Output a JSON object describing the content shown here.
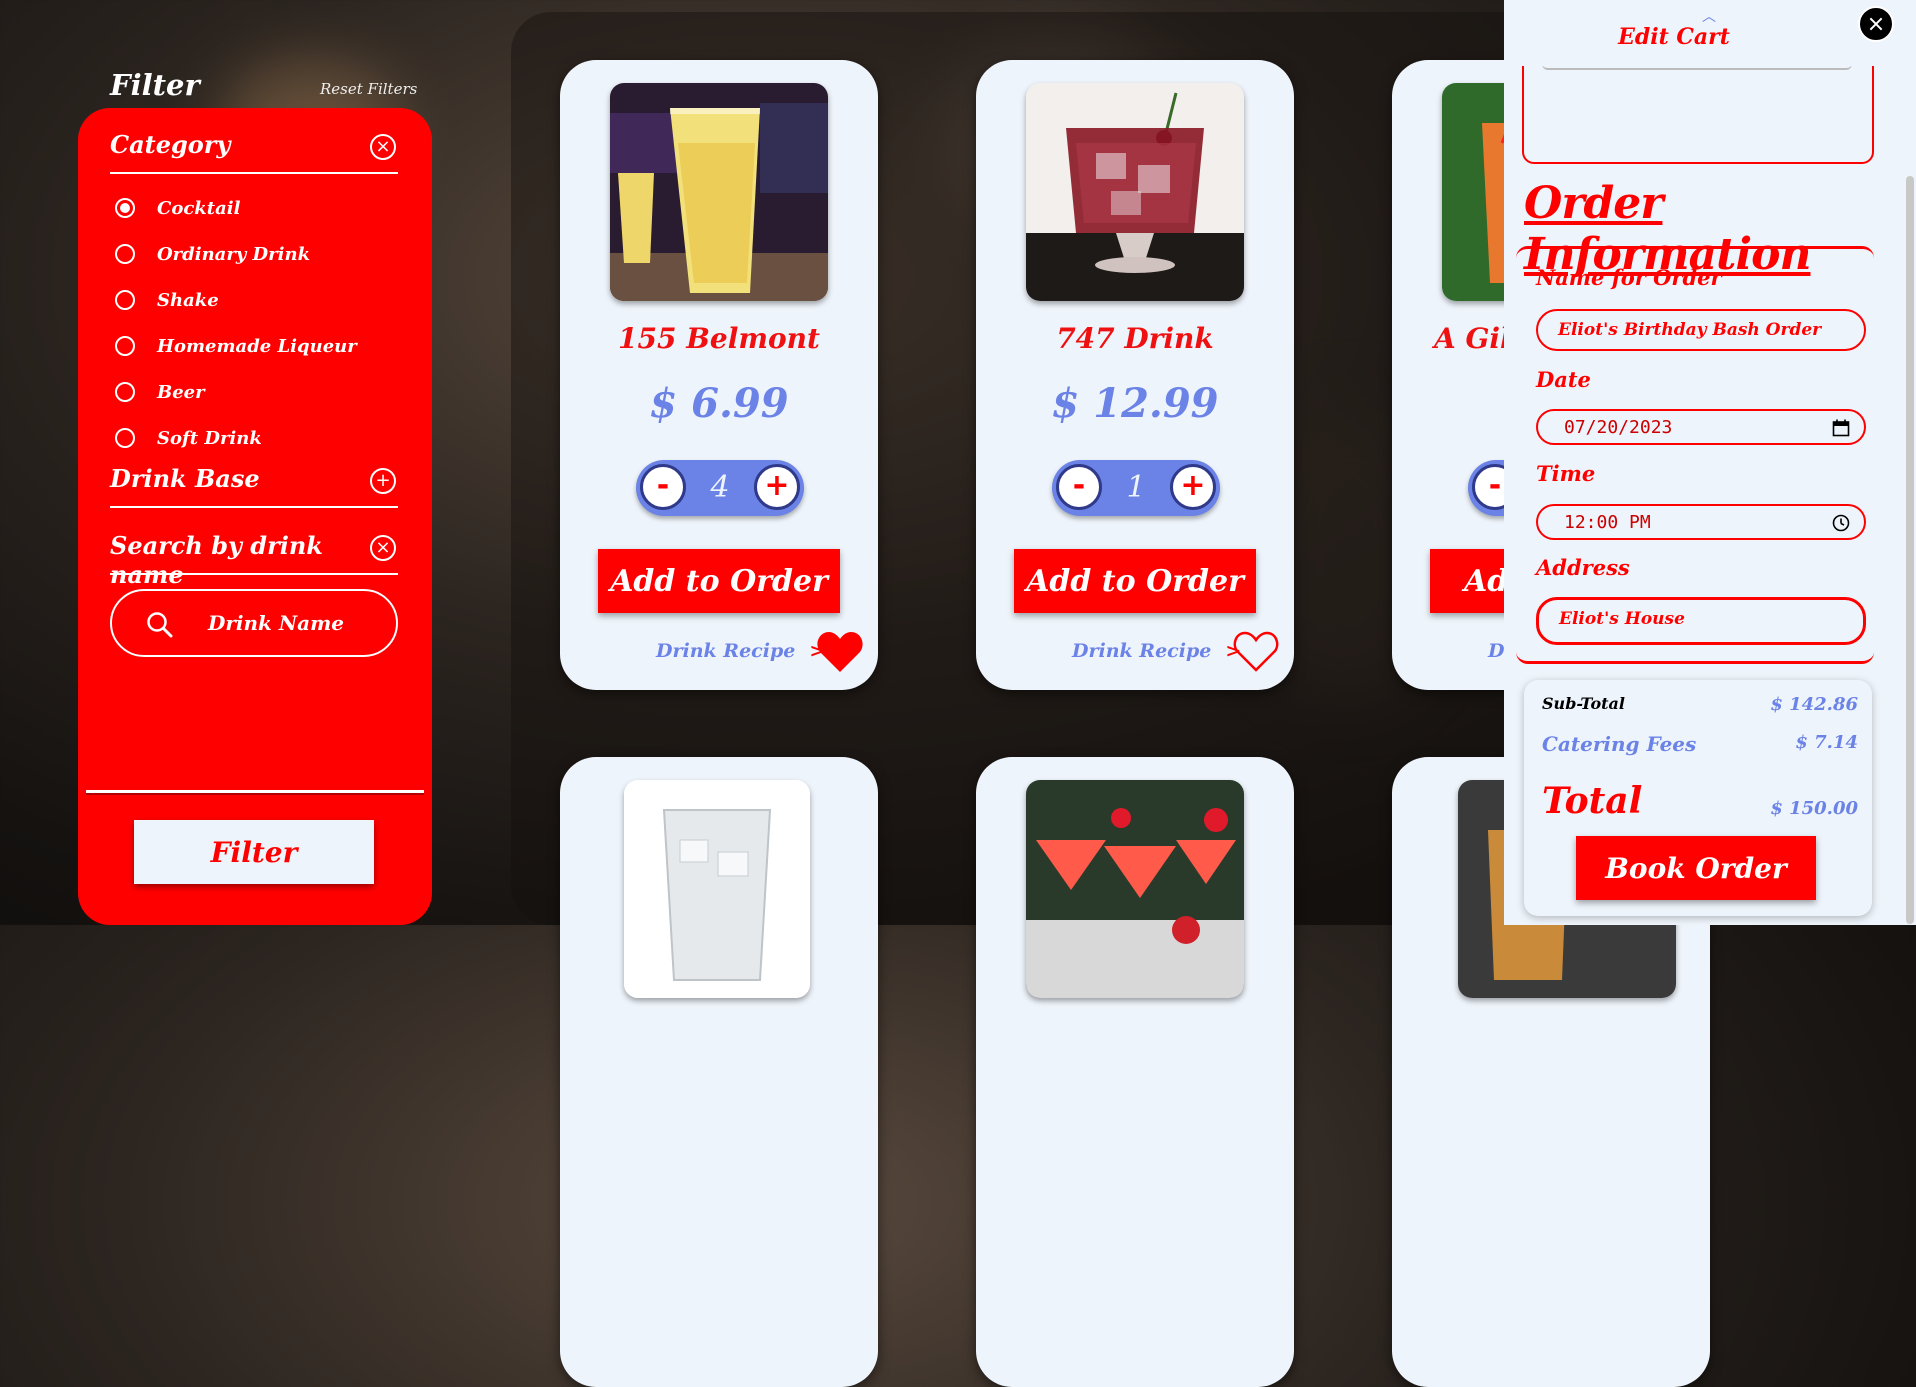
{
  "filter": {
    "title": "Filter",
    "reset_label": "Reset Filters",
    "category_label": "Category",
    "categories": [
      {
        "label": "Cocktail",
        "selected": true
      },
      {
        "label": "Ordinary Drink",
        "selected": false
      },
      {
        "label": "Shake",
        "selected": false
      },
      {
        "label": "Homemade Liqueur",
        "selected": false
      },
      {
        "label": "Beer",
        "selected": false
      },
      {
        "label": "Soft Drink",
        "selected": false
      }
    ],
    "drink_base_label": "Drink Base",
    "search_label": "Search by drink name",
    "search_placeholder": "Drink Name",
    "filter_button": "Filter"
  },
  "products": [
    {
      "name": "155 Belmont",
      "price": "$ 6.99",
      "qty": "4",
      "add_label": "Add to Order",
      "recipe_label": "Drink Recipe",
      "recipe_arrow": ">",
      "favorited": true
    },
    {
      "name": "747 Drink",
      "price": "$ 12.99",
      "qty": "1",
      "add_label": "Add to Order",
      "recipe_label": "Drink Recipe",
      "recipe_arrow": ">",
      "favorited": false
    },
    {
      "name": "A Gill",
      "price": "",
      "qty": "",
      "add_label": "Add",
      "recipe_label": "Dr",
      "recipe_arrow": "",
      "favorited": false
    }
  ],
  "cart": {
    "title": "Edit Cart",
    "order_info_title": "Order Information",
    "name_label": "Name for Order",
    "name_value": "Eliot's Birthday Bash Order",
    "date_label": "Date",
    "date_value": "07/20/2023",
    "time_label": "Time",
    "time_value": "12:00 PM",
    "address_label": "Address",
    "address_value": "Eliot's House",
    "subtotal_label": "Sub-Total",
    "subtotal_value": "$ 142.86",
    "fees_label": "Catering Fees",
    "fees_value": "$ 7.14",
    "total_label": "Total",
    "total_value": "$ 150.00",
    "book_label": "Book Order"
  },
  "colors": {
    "accent": "#ff0000",
    "price_blue": "#6b82e6",
    "card_bg": "#eef4fb"
  }
}
